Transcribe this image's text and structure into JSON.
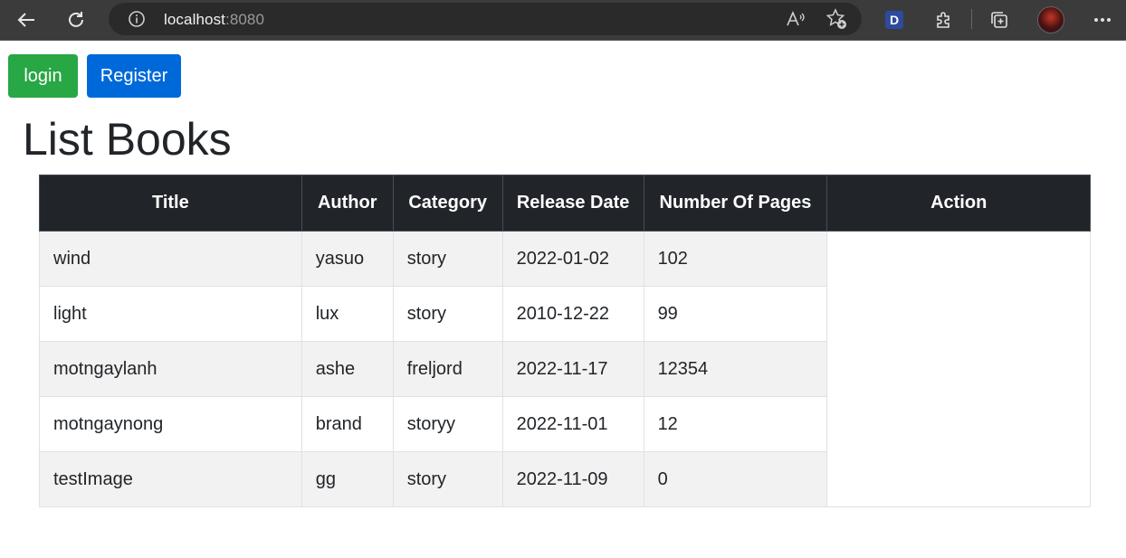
{
  "browser": {
    "url_host": "localhost",
    "url_port": ":8080",
    "profile_badge": "D"
  },
  "page": {
    "login_label": "login",
    "register_label": "Register",
    "title": "List Books"
  },
  "table": {
    "headers": [
      "Title",
      "Author",
      "Category",
      "Release Date",
      "Number Of Pages",
      "Action"
    ],
    "rows": [
      {
        "title": "wind",
        "author": "yasuo",
        "category": "story",
        "release_date": "2022-01-02",
        "pages": "102"
      },
      {
        "title": "light",
        "author": "lux",
        "category": "story",
        "release_date": "2010-12-22",
        "pages": "99"
      },
      {
        "title": "motngaylanh",
        "author": "ashe",
        "category": "freljord",
        "release_date": "2022-11-17",
        "pages": "12354"
      },
      {
        "title": "motngaynong",
        "author": "brand",
        "category": "storyy",
        "release_date": "2022-11-01",
        "pages": "12"
      },
      {
        "title": "testImage",
        "author": "gg",
        "category": "story",
        "release_date": "2022-11-09",
        "pages": "0"
      }
    ]
  },
  "colors": {
    "login_button": "#28a745",
    "register_button": "#0069d9",
    "table_header": "#212529",
    "striped_row": "#f2f2f2"
  }
}
